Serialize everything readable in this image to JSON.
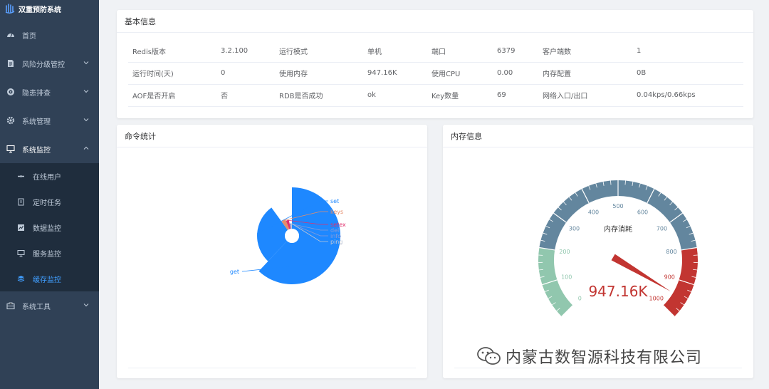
{
  "sidebar": {
    "brand": "双重预防系统",
    "menu": [
      {
        "label": "首页",
        "icon": "dashboard-icon",
        "has_chevron": false
      },
      {
        "label": "风险分级管控",
        "icon": "document-icon",
        "has_chevron": true
      },
      {
        "label": "隐患排查",
        "icon": "target-icon",
        "has_chevron": true
      },
      {
        "label": "系统管理",
        "icon": "gear-icon",
        "has_chevron": true
      },
      {
        "label": "系统监控",
        "icon": "monitor-icon",
        "has_chevron": true,
        "open": true
      }
    ],
    "submenu": [
      {
        "label": "在线用户",
        "icon": "online-icon"
      },
      {
        "label": "定时任务",
        "icon": "job-icon"
      },
      {
        "label": "数据监控",
        "icon": "chart-icon"
      },
      {
        "label": "服务监控",
        "icon": "server-icon"
      },
      {
        "label": "缓存监控",
        "icon": "redis-icon",
        "active": true
      }
    ],
    "tools": {
      "label": "系统工具",
      "icon": "toolbox-icon"
    }
  },
  "basic": {
    "title": "基本信息",
    "rows": [
      [
        {
          "k": "Redis版本",
          "v": "3.2.100"
        },
        {
          "k": "运行模式",
          "v": "单机"
        },
        {
          "k": "端口",
          "v": "6379"
        },
        {
          "k": "客户端数",
          "v": "1"
        }
      ],
      [
        {
          "k": "运行时间(天)",
          "v": "0"
        },
        {
          "k": "使用内存",
          "v": "947.16K"
        },
        {
          "k": "使用CPU",
          "v": "0.00"
        },
        {
          "k": "内存配置",
          "v": "0B"
        }
      ],
      [
        {
          "k": "AOF是否开启",
          "v": "否"
        },
        {
          "k": "RDB是否成功",
          "v": "ok"
        },
        {
          "k": "Key数量",
          "v": "69"
        },
        {
          "k": "网络入口/出口",
          "v": "0.04kps/0.66kps"
        }
      ]
    ]
  },
  "cmd": {
    "title": "命令统计"
  },
  "mem": {
    "title": "内存信息"
  },
  "chart_data": [
    {
      "type": "pie",
      "title": "",
      "variant": "rose",
      "categories": [
        "get",
        "set",
        "keys",
        "setex",
        "del",
        "info",
        "ping"
      ],
      "values": [
        62,
        28,
        4,
        3,
        1,
        1,
        1
      ],
      "colors": [
        "#1e88ff",
        "#1e88ff",
        "#e58d6c",
        "#e0316e",
        "#8a9bd8",
        "#8a9bd8",
        "#c0c7d6"
      ]
    },
    {
      "type": "gauge",
      "title": "",
      "name": "内存消耗",
      "min": 0,
      "max": 1000,
      "value": 947.16,
      "value_text": "947.16K",
      "ticks": [
        "0",
        "100",
        "200",
        "300",
        "400",
        "500",
        "600",
        "700",
        "800",
        "900",
        "1000"
      ],
      "bands": [
        {
          "to": 0.2,
          "color": "#91c7ae"
        },
        {
          "to": 0.8,
          "color": "#63869e"
        },
        {
          "to": 1.0,
          "color": "#c23531"
        }
      ]
    }
  ],
  "watermark": {
    "text": "内蒙古数智源科技有限公司"
  }
}
